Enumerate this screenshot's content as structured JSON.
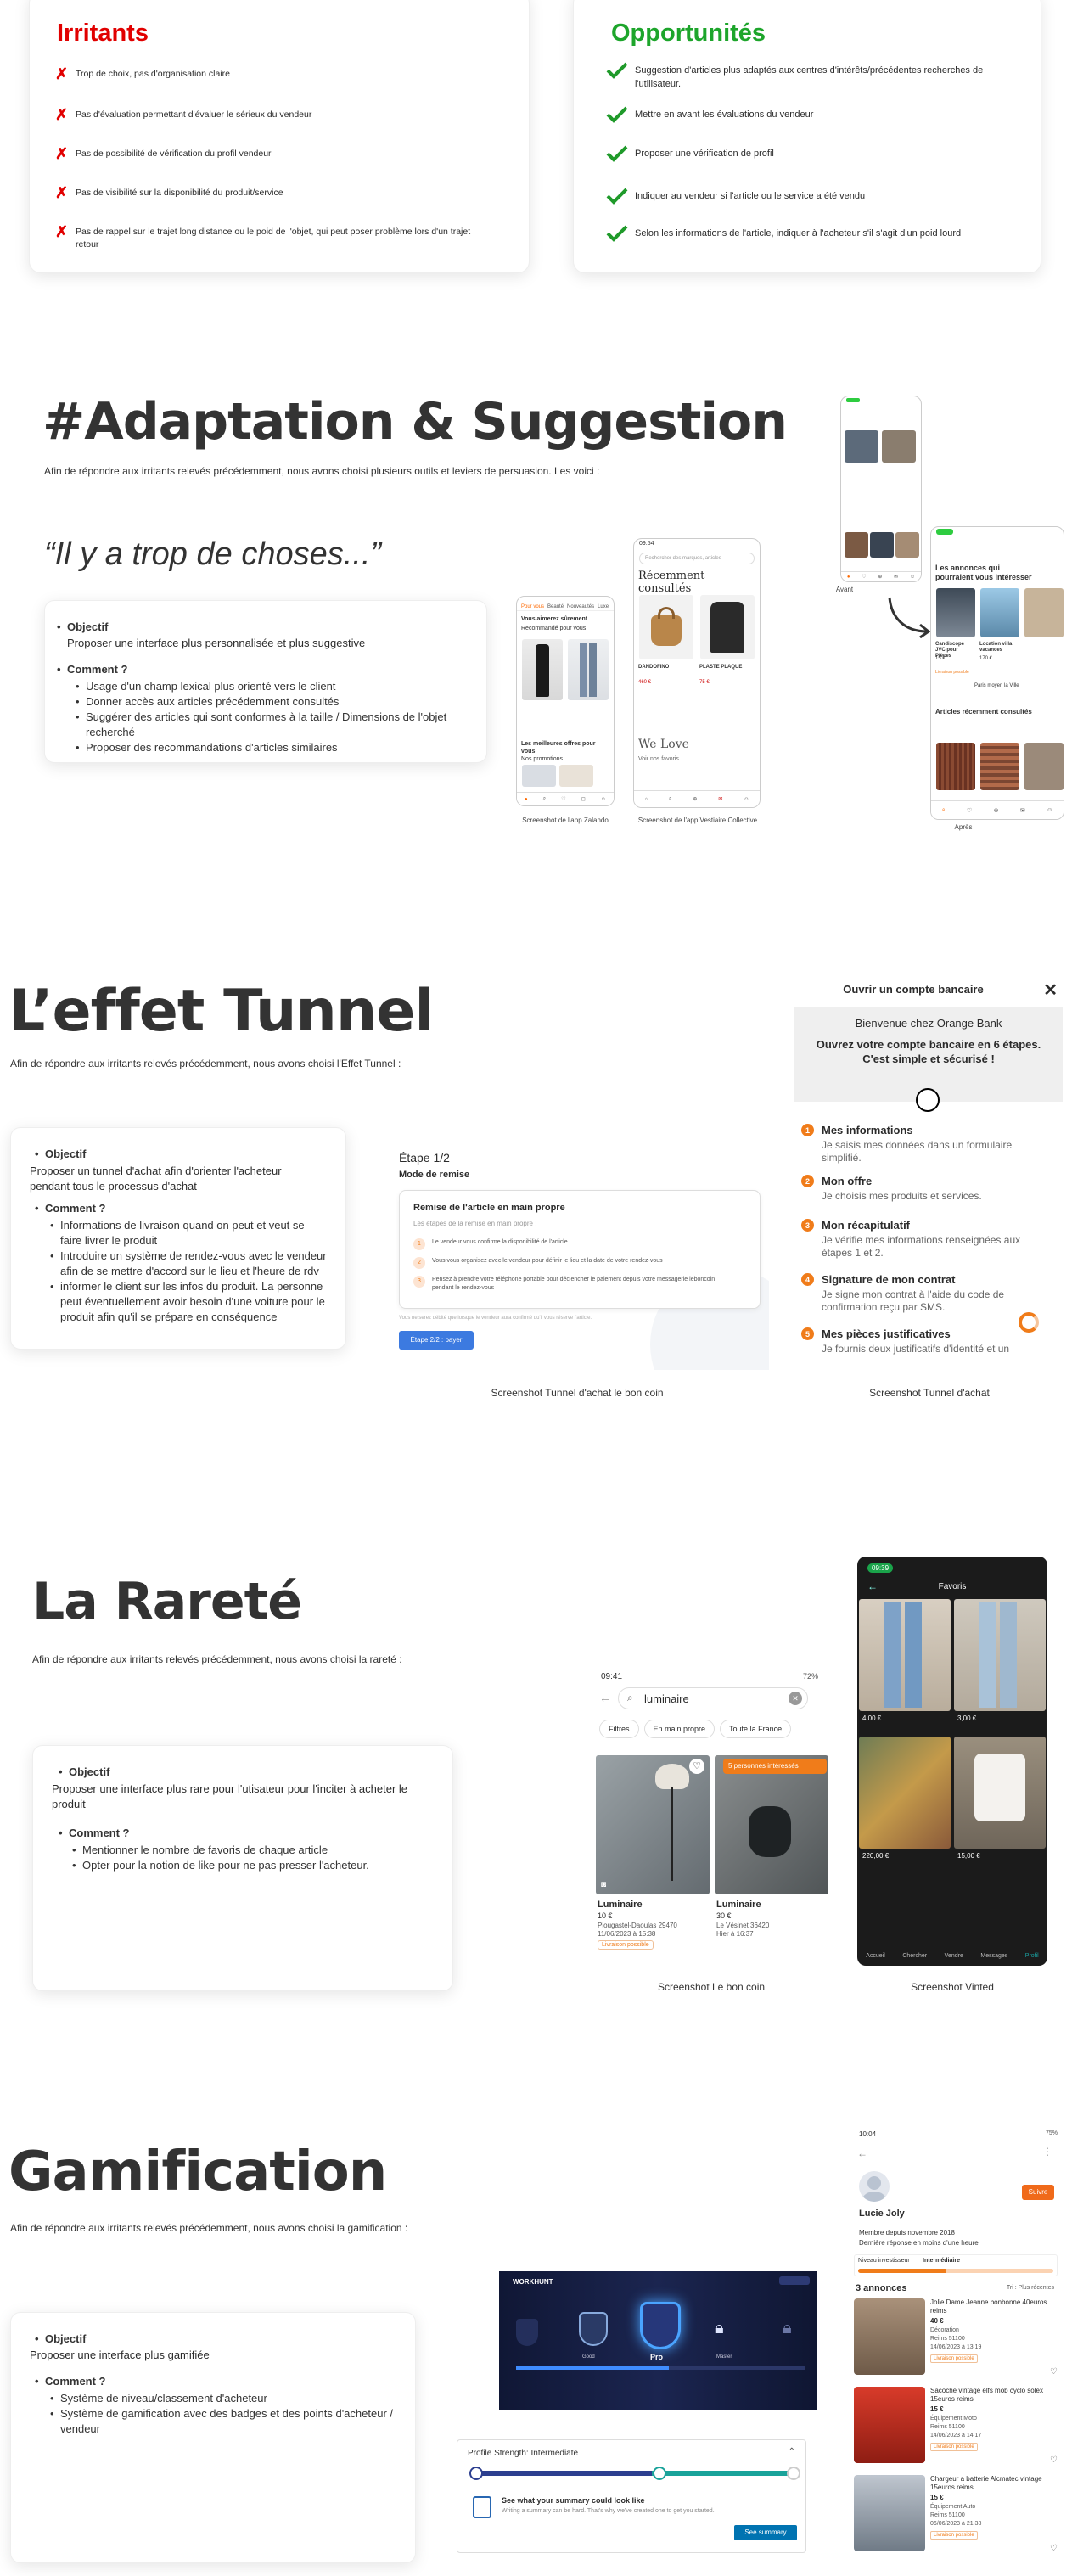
{
  "irritants": {
    "title": "Irritants",
    "items": [
      "Trop de choix, pas d'organisation claire",
      "Pas d'évaluation permettant d'évaluer le sérieux du vendeur",
      "Pas de possibilité de vérification du profil vendeur",
      "Pas de visibilité sur la disponibilité du produit/service",
      "Pas de rappel sur le  trajet long distance ou le poid de l'objet, qui peut poser problème lors d'un trajet retour"
    ]
  },
  "opportunites": {
    "title": "Opportunités",
    "items": [
      "Suggestion d'articles plus adaptés aux centres d'intérêts/précédentes recherches de l'utilisateur.",
      "Mettre en avant les évaluations du vendeur",
      "Proposer une vérification de profil",
      "Indiquer au vendeur si l'article ou le service a été vendu",
      "Selon les informations de l'article, indiquer à l'acheteur s'il s'agit d'un poid lourd"
    ]
  },
  "adaptation": {
    "title": "#Adaptation & Suggestion",
    "intro": "Afin de répondre aux irritants relevés précédemment, nous avons choisi plusieurs outils et leviers de persuasion. Les voici :",
    "quote": "“Il y a trop de choses...”",
    "objectif_label": "Objectif",
    "objectif_text": "Proposer une interface plus personnalisée et plus suggestive",
    "comment_label": "Comment ?",
    "comment_items": [
      "Usage d'un champ lexical plus orienté vers le client",
      "Donner accès aux articles précédemment consultés",
      "Suggérer des articles qui sont conformes à la taille / Dimensions de l'objet recherché",
      "Proposer des recommandations d'articles similaires"
    ],
    "caption_zalando": "Screenshot de l'app Zalando",
    "caption_vestiaire": "Screenshot de l'app Vestiaire Collective",
    "caption_avant": "Avant",
    "caption_apres": "Après",
    "zalando": {
      "tabs": [
        "Pour vous",
        "Beauté",
        "Nouveautés",
        "Luxe"
      ],
      "title": "Vous aimerez sûrement",
      "subtitle": "Recommandé pour vous",
      "section2": "Les meilleures offres pour vous",
      "section2_sub": "Nos promotions"
    },
    "vestiaire": {
      "time": "09:54",
      "search": "Rechercher des marques, articles",
      "title": "Récemment consultés",
      "item1_brand": "DANDOFINO",
      "item1_price": "460 €",
      "item2_brand": "PLASTE PLAQUE",
      "item2_price": "75 €",
      "love_title": "We Love",
      "love_sub": "Voir nos favoris"
    },
    "lbc": {
      "section1": "Les annonces qui pourraient vous intéresser",
      "item1": "Candiscope JVC pour Pièces",
      "item1_price": "15 €",
      "item2": "Location villa vacances",
      "item2_price": "170 €",
      "badge": "Livraison possible",
      "section2": "Articles récemment consultés",
      "location": "Paris moyen la Ville"
    }
  },
  "tunnel": {
    "title": "L’effet Tunnel",
    "intro": "Afin de répondre aux irritants relevés précédemment, nous avons choisi l'Effet Tunnel :",
    "objectif_label": "Objectif",
    "objectif_text": "Proposer un tunnel d'achat afin d'orienter l'acheteur pendant tous le processus d'achat",
    "comment_label": "Comment ?",
    "comment_items": [
      "Informations de livraison quand on peut et veut se faire livrer le produit",
      "Introduire un système de rendez-vous avec le vendeur afin de se mettre d'accord sur le lieu et l'heure de rdv",
      "informer le client sur les infos du produit. La personne peut éventuellement avoir besoin d'une voiture pour le produit afin qu'il se prépare en conséquence"
    ],
    "lbc": {
      "step": "Étape 1/2",
      "mode": "Mode de remise",
      "box_title": "Remise de l'article en main propre",
      "box_sub": "Les étapes de la remise en main propre :",
      "steps": [
        "Le vendeur vous confirme la disponibilité de l'article",
        "Vous vous organisez avec le vendeur pour définir le lieu et la date de votre rendez-vous",
        "Pensez à prendre votre téléphone portable pour déclencher le paiement depuis votre messagerie leboncoin pendant le rendez-vous"
      ],
      "note": "Vous ne serez débité que lorsque le vendeur aura confirmé qu'il vous réserve l'article.",
      "button": "Étape 2/2 : payer",
      "caption": "Screenshot Tunnel d'achat le bon coin"
    },
    "orange": {
      "header": "Ouvrir un compte bancaire",
      "welcome": "Bienvenue chez Orange Bank",
      "headline": "Ouvrez votre compte bancaire en 6 étapes. C'est simple et sécurisé !",
      "steps": [
        {
          "n": "1",
          "t": "Mes informations",
          "d": "Je saisis mes données dans un formulaire simplifié."
        },
        {
          "n": "2",
          "t": "Mon offre",
          "d": "Je choisis mes produits et services."
        },
        {
          "n": "3",
          "t": "Mon récapitulatif",
          "d": "Je vérifie mes informations renseignées aux étapes 1 et 2."
        },
        {
          "n": "4",
          "t": "Signature de mon contrat",
          "d": "Je signe mon contrat à l'aide du code de confirmation reçu par SMS."
        },
        {
          "n": "5",
          "t": "Mes pièces justificatives",
          "d": "Je fournis deux justificatifs d'identité et un"
        }
      ],
      "caption": "Screenshot Tunnel d'achat"
    }
  },
  "rarete": {
    "title": "La Rareté",
    "intro": "Afin de répondre aux irritants relevés précédemment, nous avons choisi la rareté :",
    "objectif_label": "Objectif",
    "objectif_text": "Proposer une interface plus rare pour l'utisateur pour l'inciter à acheter le produit",
    "comment_label": "Comment ?",
    "comment_items": [
      "Mentionner le nombre de favoris de chaque article",
      "Opter pour la notion de like pour ne pas presser l'acheteur."
    ],
    "lbc": {
      "time": "09:41",
      "battery": "72%",
      "search": "luminaire",
      "filters": [
        "Filtres",
        "En main propre",
        "Toute la France"
      ],
      "badge": "5 personnes intéressés",
      "item1_title": "Luminaire",
      "item1_price": "10 €",
      "item1_loc": "Plougastel-Daoulas 29470",
      "item1_date": "11/06/2023 à 15:38",
      "item2_title": "Luminaire",
      "item2_price": "30 €",
      "item2_loc": "Le Vésinet 36420",
      "item2_date": "Hier à 16:37",
      "delivery": "Livraison possible",
      "caption": "Screenshot Le bon coin"
    },
    "vinted": {
      "time": "09:39",
      "title": "Favoris",
      "prices": [
        "4,00 €",
        "3,00 €",
        "220,00 €",
        "15,00 €"
      ],
      "nav": [
        "Accueil",
        "Chercher",
        "Vendre",
        "Messages",
        "Profil"
      ],
      "caption": "Screenshot Vinted"
    }
  },
  "gamification": {
    "title": "Gamification",
    "intro": "Afin de répondre aux irritants relevés précédemment, nous avons choisi la gamification :",
    "objectif_label": "Objectif",
    "objectif_text": "Proposer une interface plus gamifiée",
    "comment_label": "Comment ?",
    "comment_items": [
      "Système de niveau/classement d'acheteur",
      "Système de gamification avec des badges et des points d'acheteur / vendeur"
    ],
    "workhunt": {
      "brand": "WORKHUNT",
      "levels": [
        "Good",
        "Pro",
        "Master"
      ]
    },
    "linkedin": {
      "strength": "Profile Strength: Intermediate",
      "summary_title": "See what your summary could look like",
      "summary_sub": "Writing a summary can be hard. That's why we've created one to get you started.",
      "button": "See summary"
    },
    "profile": {
      "time": "10:04",
      "battery": "75%",
      "name": "Lucie Joly",
      "follow": "Suivre",
      "member": "Membre depuis novembre 2018",
      "reply": "Dernière réponse en moins d'une heure",
      "level_label": "Niveau investisseur :",
      "level": "Intermédiaire",
      "count": "3 annonces",
      "sort": "Tri : Plus récentes",
      "items": [
        {
          "t": "Jolie Dame Jeanne bonbonne 40euros reims",
          "p": "40 €",
          "c": "Décoration",
          "l": "Reims 51100",
          "d": "14/06/2023 à 13:19"
        },
        {
          "t": "Sacoche vintage elfs mob cyclo solex 15euros reims",
          "p": "15 €",
          "c": "Équipement Moto",
          "l": "Reims 51100",
          "d": "14/06/2023 à 14:17"
        },
        {
          "t": "Chargeur a batterie Alcmatec vintage 15euros reims",
          "p": "15 €",
          "c": "Équipement Auto",
          "l": "Reims 51100",
          "d": "06/06/2023 à 21:38"
        }
      ],
      "delivery": "Livraison possible"
    }
  }
}
